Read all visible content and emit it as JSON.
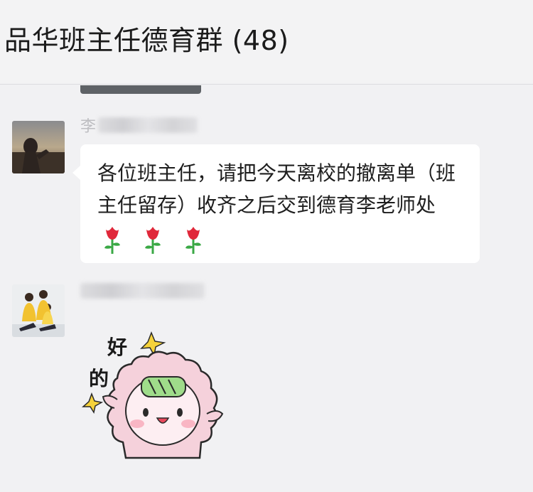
{
  "header": {
    "title": "品华班主任德育群 (48)"
  },
  "messages": [
    {
      "sender_visible": "李",
      "avatar": "profile-photo-icon",
      "text": "各位班主任，请把今天离校的撤离单（班主任留存）收齐之后交到德育李老师处",
      "emoji": [
        "rose-icon",
        "rose-icon",
        "rose-icon"
      ]
    },
    {
      "avatar": "family-photo-icon",
      "sticker": {
        "name": "pink-hedgehog-ok-sticker",
        "text_top": "好",
        "text_bottom": "的"
      }
    }
  ],
  "colors": {
    "header_bg": "#f3f3f4",
    "chat_bg": "#f1f1f3",
    "bubble_bg": "#ffffff",
    "rose_red": "#e0283a",
    "stem_green": "#3aa845"
  }
}
